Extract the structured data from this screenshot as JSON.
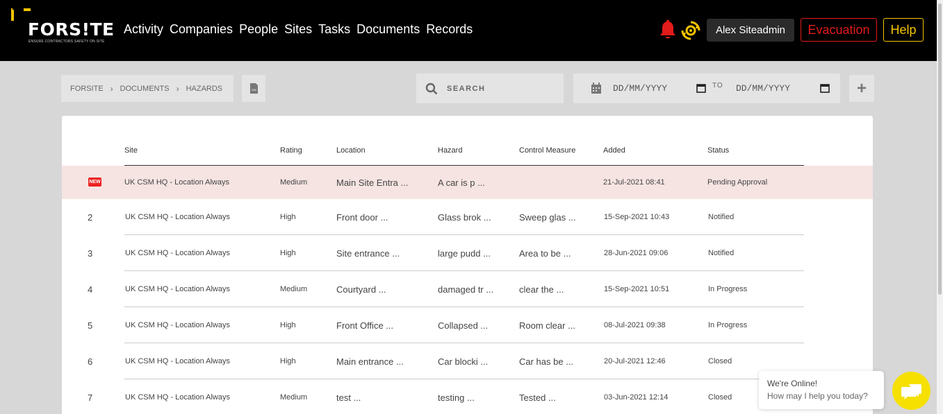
{
  "header": {
    "logo_text": "FORS!TE",
    "logo_tagline": "ENSURE CONTRACTORS SAFETY ON SITE",
    "nav": [
      "Activity",
      "Companies",
      "People",
      "Sites",
      "Tasks",
      "Documents",
      "Records"
    ],
    "user_label": "Alex Siteadmin",
    "evacuation_label": "Evacuation",
    "help_label": "Help",
    "brand_color": "#f5c400",
    "alert_color": "#e21b1b"
  },
  "breadcrumb": [
    "FORSITE",
    "DOCUMENTS",
    "HAZARDS"
  ],
  "toolbar": {
    "csv_label": "csv",
    "search_placeholder": "SEARCH",
    "date_from_placeholder": "DD/MM/YYYY",
    "date_to_label": "TO",
    "date_to_placeholder": "DD/MM/YYYY",
    "add_label": "+"
  },
  "table": {
    "columns": [
      "Site",
      "Rating",
      "Location",
      "Hazard",
      "Control Measure",
      "Added",
      "Status"
    ],
    "new_badge": "NEW",
    "rows": [
      {
        "index": "",
        "is_new": true,
        "site": "UK CSM HQ - Location Always",
        "rating": "Medium",
        "location": "Main Site Entra ...",
        "hazard": "A car is p ...",
        "control": "",
        "added": "21-Jul-2021 08:41",
        "status": "Pending Approval"
      },
      {
        "index": "2",
        "is_new": false,
        "site": "UK CSM HQ - Location Always",
        "rating": "High",
        "location": "Front door ...",
        "hazard": "Glass brok ...",
        "control": "Sweep glas ...",
        "added": "15-Sep-2021 10:43",
        "status": "Notified"
      },
      {
        "index": "3",
        "is_new": false,
        "site": "UK CSM HQ - Location Always",
        "rating": "High",
        "location": "Site entrance ...",
        "hazard": "large pudd ...",
        "control": "Area to be ...",
        "added": "28-Jun-2021 09:06",
        "status": "Notified"
      },
      {
        "index": "4",
        "is_new": false,
        "site": "UK CSM HQ - Location Always",
        "rating": "Medium",
        "location": "Courtyard ...",
        "hazard": "damaged tr ...",
        "control": "clear the ...",
        "added": "15-Sep-2021 10:51",
        "status": "In Progress"
      },
      {
        "index": "5",
        "is_new": false,
        "site": "UK CSM HQ - Location Always",
        "rating": "High",
        "location": "Front Office ...",
        "hazard": "Collapsed ...",
        "control": "Room clear ...",
        "added": "08-Jul-2021 09:38",
        "status": "In Progress"
      },
      {
        "index": "6",
        "is_new": false,
        "site": "UK CSM HQ - Location Always",
        "rating": "High",
        "location": "Main entrance ...",
        "hazard": "Car blocki ...",
        "control": "Car has be ...",
        "added": "20-Jul-2021 12:46",
        "status": "Closed"
      },
      {
        "index": "7",
        "is_new": false,
        "site": "UK CSM HQ - Location Always",
        "rating": "Medium",
        "location": "test ...",
        "hazard": "testing ...",
        "control": "Tested ...",
        "added": "03-Jun-2021 12:14",
        "status": "Closed"
      }
    ]
  },
  "chat": {
    "line1": "We're Online!",
    "line2": "How may I help you today?"
  }
}
